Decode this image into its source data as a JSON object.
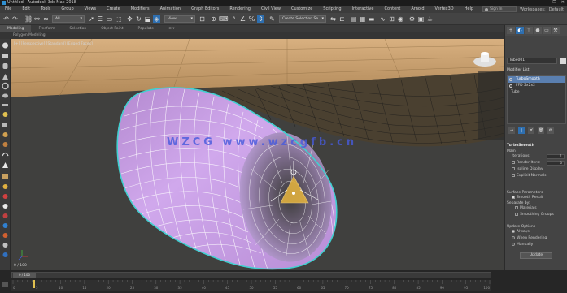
{
  "window": {
    "title": "Untitled - Autodesk 3ds Max 2018",
    "controls": [
      "–",
      "❐",
      "✕"
    ]
  },
  "menu": {
    "items": [
      "File",
      "Edit",
      "Tools",
      "Group",
      "Views",
      "Create",
      "Modifiers",
      "Animation",
      "Graph Editors",
      "Rendering",
      "Civil View",
      "Customize",
      "Scripting",
      "Interactive",
      "Content",
      "Arnold",
      "Vertex3D",
      "Help"
    ],
    "signin": "Sign In",
    "workspaces_label": "Workspaces:",
    "workspaces_value": "Default"
  },
  "toolbar": {
    "filter_dropdown": "All",
    "view_dropdown": "View",
    "selection_set": "Create Selection Se"
  },
  "ribbon": {
    "tabs": [
      "Modeling",
      "Freeform",
      "Selection",
      "Object Paint",
      "Populate"
    ],
    "active_tab": 0,
    "sub_label": "Polygon Modeling"
  },
  "viewport": {
    "label": "[+] [Perspective] [Standard] [Edged Faces]",
    "frame_counter": "0 / 100",
    "watermark": "WZCG  www.wzcgfb.cn"
  },
  "command_panel": {
    "object_name": "Tube001",
    "modifier_list_label": "Modifier List",
    "modifiers": [
      {
        "name": "TurboSmooth",
        "selected": true
      },
      {
        "name": "FFD 2x2x2",
        "selected": false
      },
      {
        "name": "Tube",
        "selected": false
      }
    ],
    "turbosmooth": {
      "title": "TurboSmooth",
      "main_label": "Main",
      "iterations_label": "Iterations:",
      "iterations_value": "1",
      "render_iters_label": "Render Iters:",
      "render_iters_value": "0",
      "isoline_display": "Isoline Display",
      "explicit_normals": "Explicit Normals"
    },
    "surface": {
      "title": "Surface Parameters",
      "smooth_result": "Smooth Result",
      "separate_by": "Separate by:",
      "materials": "Materials",
      "smoothing_groups": "Smoothing Groups"
    },
    "update": {
      "title": "Update Options",
      "always": "Always",
      "when_rendering": "When Rendering",
      "manually": "Manually",
      "button": "Update"
    }
  },
  "timeline": {
    "slider_text": "0 / 100",
    "ticks": [
      "0",
      "5",
      "10",
      "15",
      "20",
      "25",
      "30",
      "35",
      "40",
      "45",
      "50",
      "55",
      "60",
      "65",
      "70",
      "75",
      "80",
      "85",
      "90",
      "95",
      "100"
    ]
  },
  "colors": {
    "tube_fill": "#c89be0",
    "tube_wire": "#ffffff",
    "selection_outline": "#40d0d0",
    "floor_wire": "#1a1a1a",
    "ground_tan": "#c8a070",
    "accent_blue": "#2e6fb0",
    "gizmo": "#e0b040"
  }
}
